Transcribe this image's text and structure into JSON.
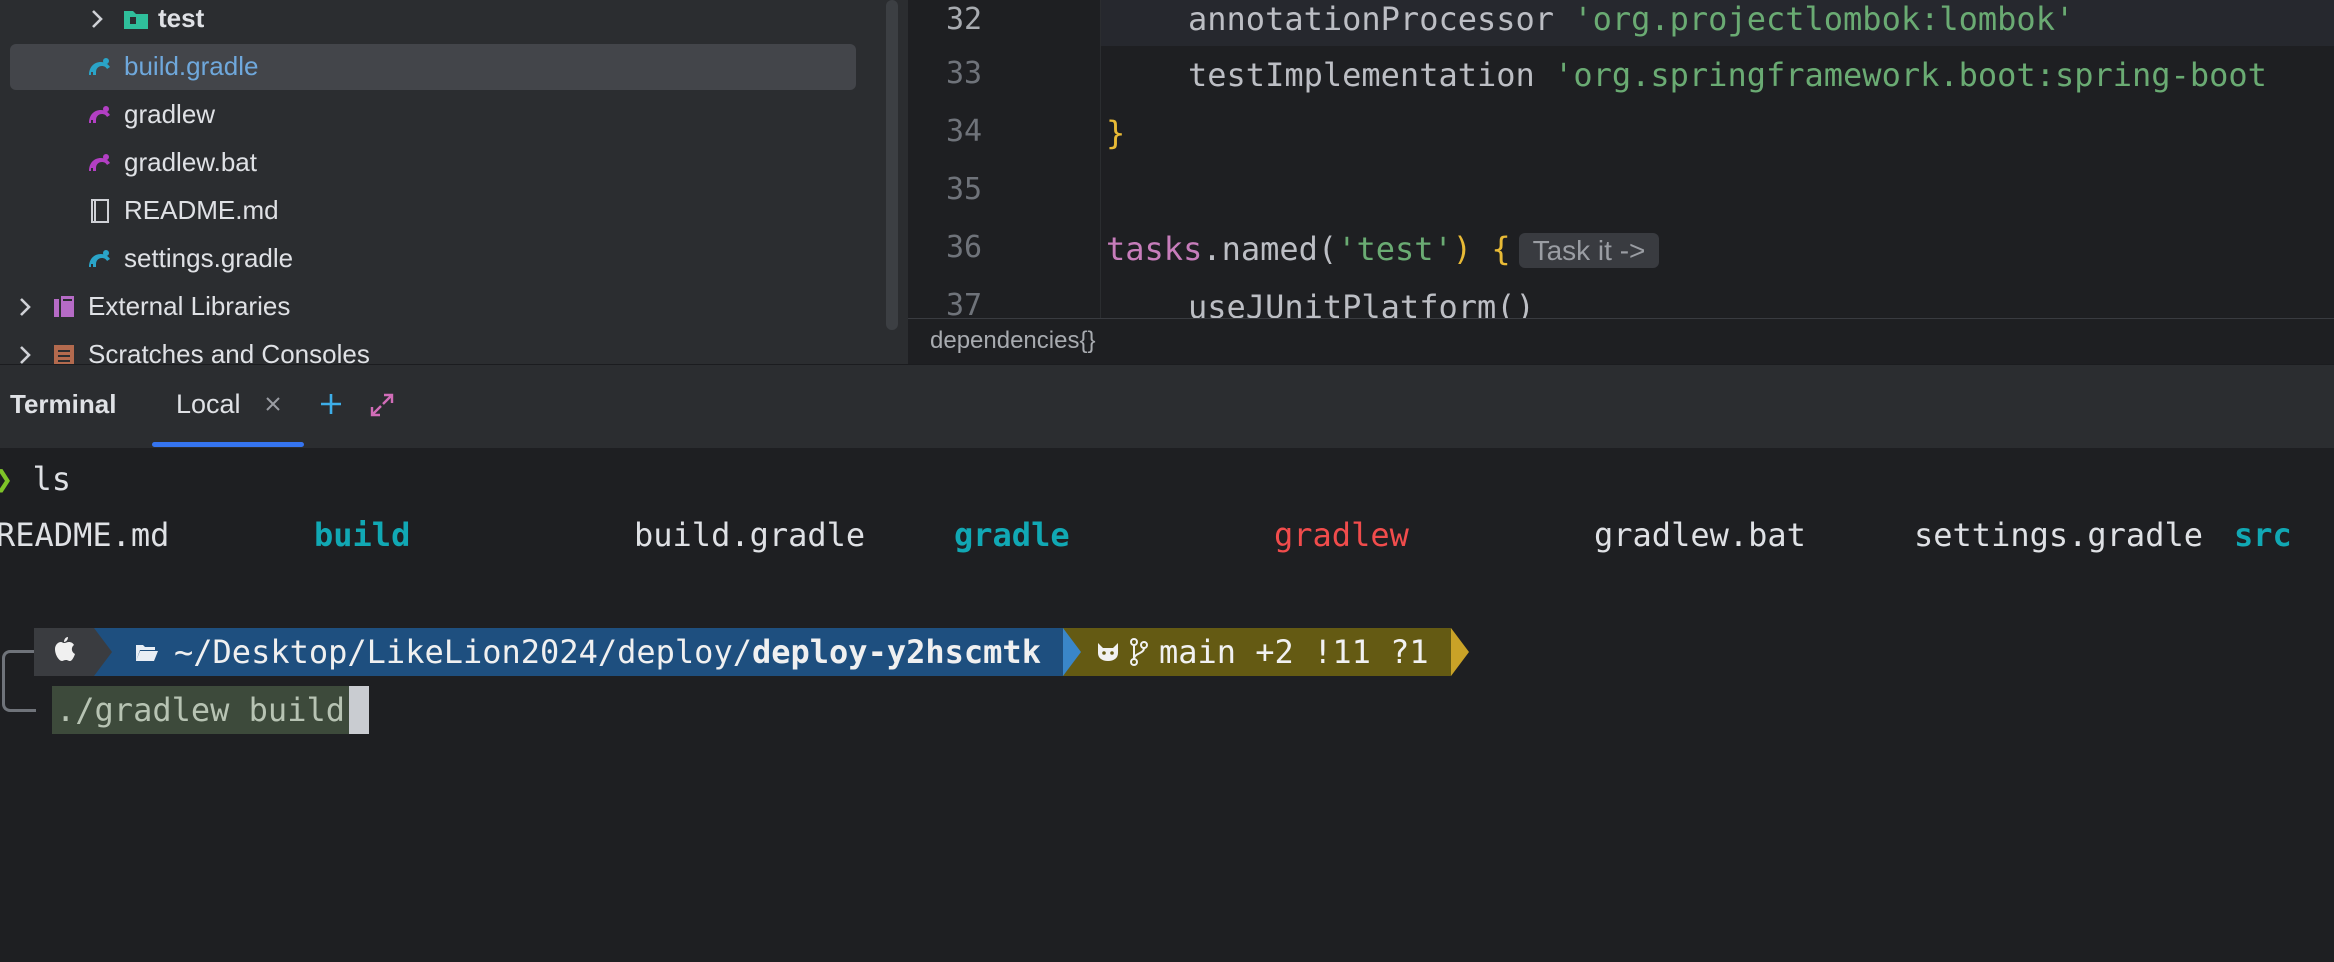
{
  "project_tree": {
    "items": [
      {
        "label": "test",
        "kind": "folder"
      },
      {
        "label": "build.gradle",
        "kind": "gradle"
      },
      {
        "label": "gradlew",
        "kind": "gradlew"
      },
      {
        "label": "gradlew.bat",
        "kind": "gradlew"
      },
      {
        "label": "README.md",
        "kind": "markdown"
      },
      {
        "label": "settings.gradle",
        "kind": "gradle"
      },
      {
        "label": "External Libraries",
        "kind": "library"
      },
      {
        "label": "Scratches and Consoles",
        "kind": "scratches"
      }
    ],
    "selected": "build.gradle"
  },
  "editor": {
    "line_numbers": [
      "32",
      "33",
      "34",
      "35",
      "36",
      "37"
    ],
    "lines": {
      "l32_ident": "annotationProcessor ",
      "l32_str": "'org.projectlombok:lombok'",
      "l33_ident": "testImplementation ",
      "l33_str": "'org.springframework.boot:spring-boot",
      "l34_brace": "}",
      "l36_kw": "tasks",
      "l36_method": ".named(",
      "l36_str": "'test'",
      "l36_close": ") ",
      "l36_brace": "{",
      "l36_hint": "Task it ->",
      "l37_code": "useJUnitPlatform()"
    },
    "breadcrumb": "dependencies{}"
  },
  "terminal": {
    "title": "Terminal",
    "tab_label": "Local",
    "command_ls": "ls",
    "ls_output": [
      {
        "name": "README.md",
        "type": "file"
      },
      {
        "name": "build",
        "type": "dir"
      },
      {
        "name": "build.gradle",
        "type": "file"
      },
      {
        "name": "gradle",
        "type": "dir"
      },
      {
        "name": "gradlew",
        "type": "exec"
      },
      {
        "name": "gradlew.bat",
        "type": "file"
      },
      {
        "name": "settings.gradle",
        "type": "file"
      },
      {
        "name": "src",
        "type": "dir"
      }
    ],
    "prompt": {
      "path_prefix": "~/Desktop/LikeLion2024/deploy/",
      "path_current": "deploy-y2hscmtk",
      "git_status": "main +2 !11 ?1"
    },
    "current_input": "./gradlew build"
  },
  "colors": {
    "accent": "#3574f0",
    "dir": "#11a8b4",
    "exec": "#f14c4c",
    "string": "#6aab73",
    "brace": "#e8ba36",
    "keyword": "#c77dbb"
  }
}
